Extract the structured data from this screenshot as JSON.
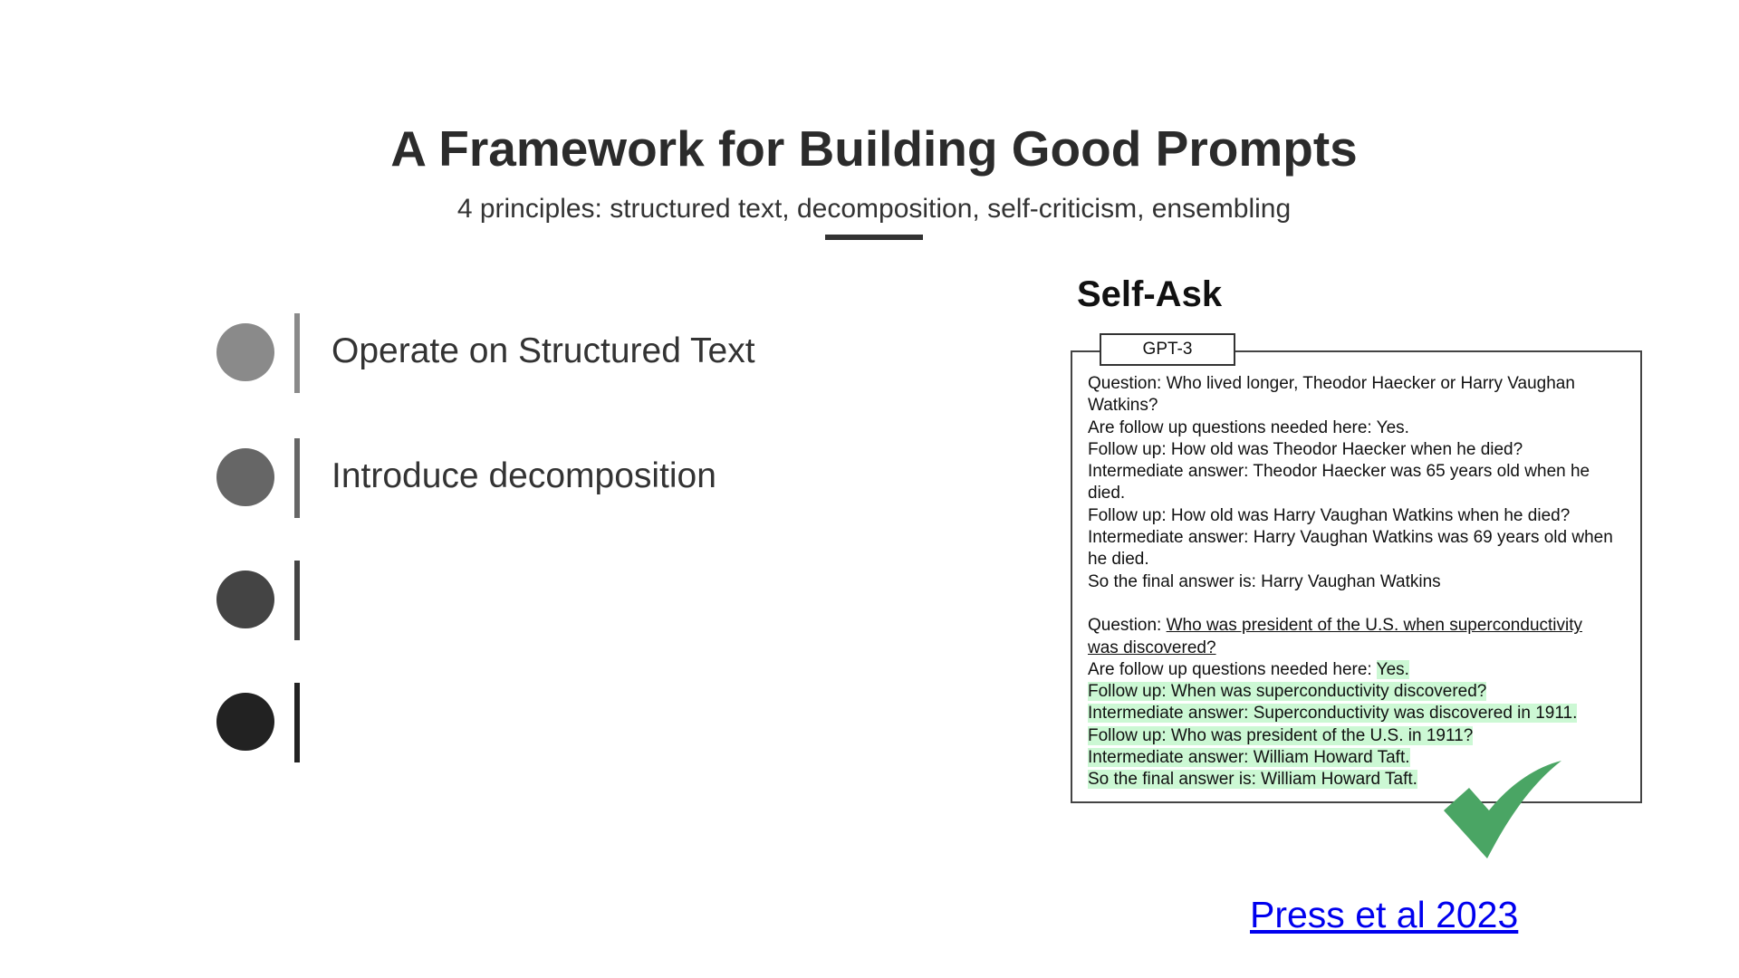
{
  "slide": {
    "title": "A Framework for Building Good Prompts",
    "subtitle": "4 principles: structured text, decomposition, self-criticism, ensembling"
  },
  "principles": [
    {
      "label": "Operate on Structured Text",
      "color": "#8a8a8a"
    },
    {
      "label": "Introduce decomposition",
      "color": "#666666"
    },
    {
      "label": "",
      "color": "#444444"
    },
    {
      "label": "",
      "color": "#222222"
    }
  ],
  "figure": {
    "heading": "Self-Ask",
    "model_tab": "GPT-3",
    "example_lines": [
      "Question: Who lived longer, Theodor Haecker or Harry Vaughan",
      "Watkins?",
      "Are follow up questions needed here: Yes.",
      "Follow up: How old was Theodor Haecker when he died?",
      "Intermediate answer: Theodor Haecker was 65 years old when he",
      "died.",
      "Follow up: How old was Harry Vaughan Watkins when he died?",
      "Intermediate answer: Harry Vaughan Watkins was 69 years old when",
      "he died.",
      "So the final answer is: Harry Vaughan Watkins"
    ],
    "query_prefix": "Question: ",
    "query_line1": "Who was president of the U.S. when superconductivity",
    "query_line2": "was discovered?",
    "followup_prefix": "Are follow up questions needed here: ",
    "followup_answer": "Yes.",
    "generated_lines": [
      "Follow up: When was superconductivity discovered?",
      "Intermediate answer: Superconductivity was discovered in 1911.",
      "Follow up: Who was president of the U.S. in 1911?",
      "Intermediate answer: William Howard Taft.",
      "So the final answer is: William Howard Taft."
    ],
    "highlight_color": "#ccf8d4",
    "check_color": "#4aa564",
    "check_icon": "checkmark-icon"
  },
  "citation": {
    "label": "Press et al 2023"
  }
}
